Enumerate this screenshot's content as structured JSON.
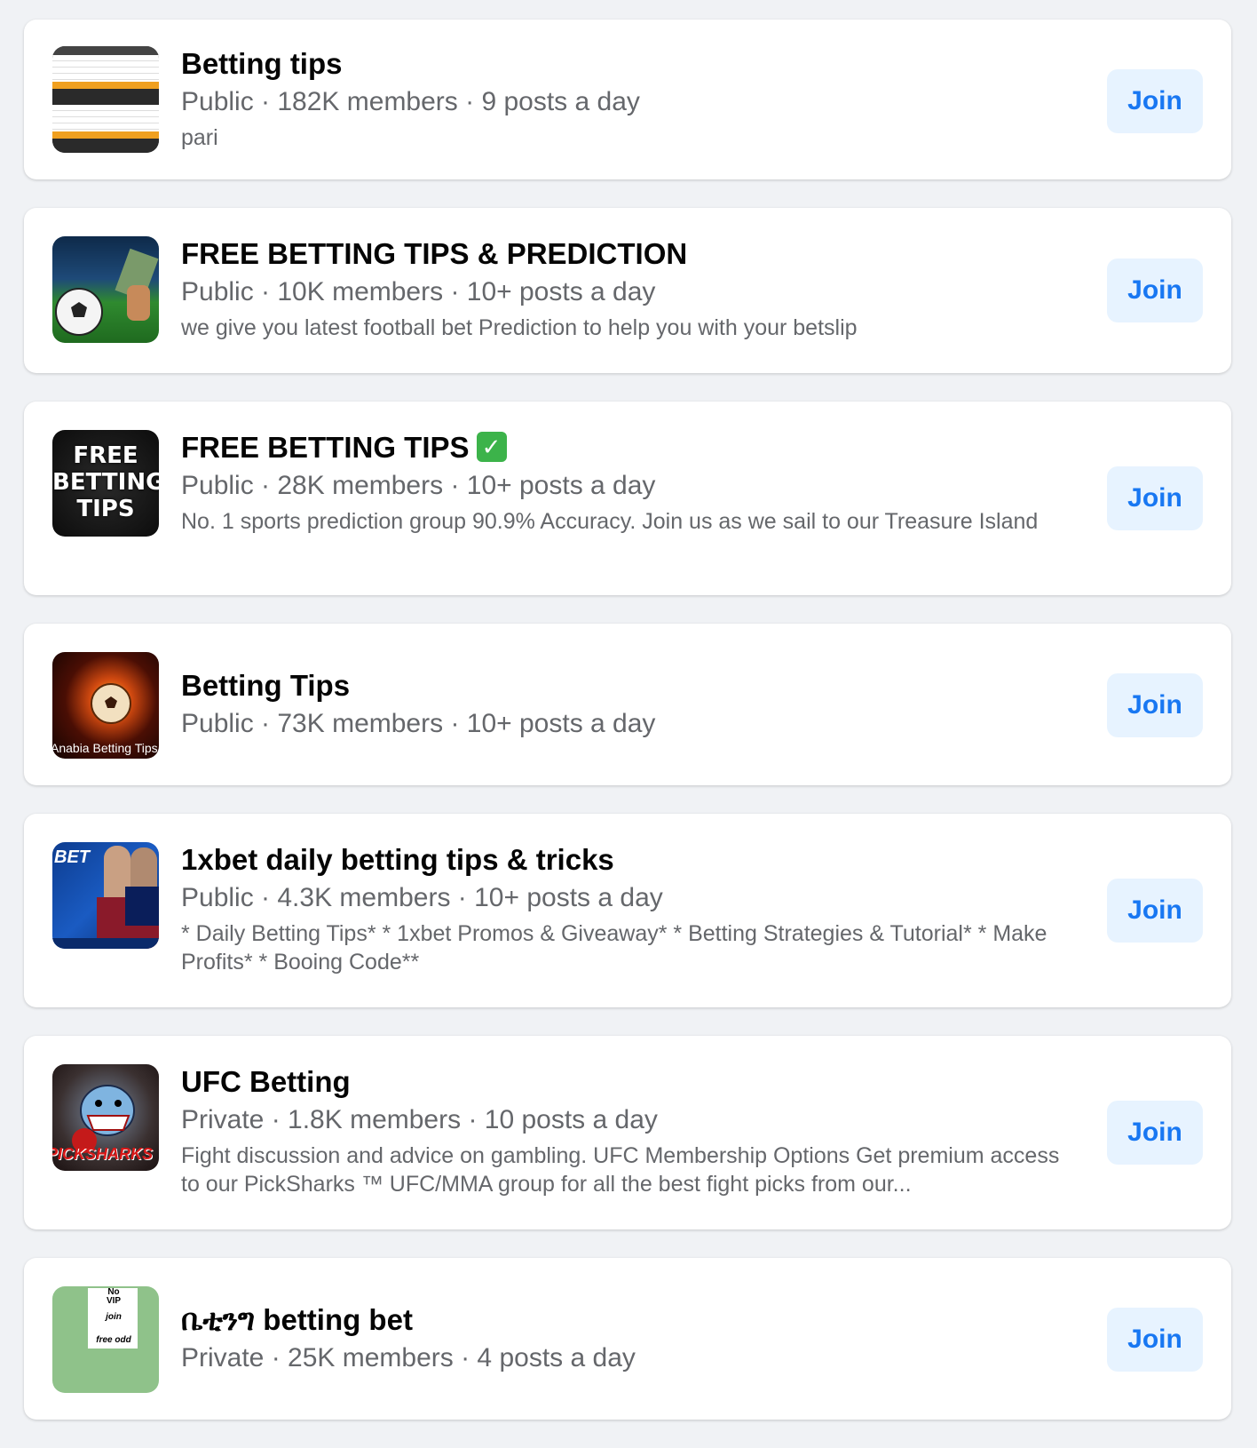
{
  "groups": [
    {
      "title": "Betting tips",
      "meta": "Public · 182K members · 9 posts a day",
      "description": "pari",
      "join_label": "Join"
    },
    {
      "title": "FREE BETTING TIPS & PREDICTION",
      "meta": "Public · 10K members · 10+ posts a day",
      "description": "we give you latest football bet Prediction to help you with your betslip",
      "join_label": "Join"
    },
    {
      "title": "FREE BETTING TIPS",
      "meta": "Public · 28K members · 10+ posts a day",
      "description": "No. 1 sports prediction group 90.9% Accuracy. Join us as we sail to our Treasure Island",
      "join_label": "Join",
      "thumb_text": [
        "FREE",
        "BETTING",
        "TIPS"
      ],
      "title_icon": "check-mark-icon"
    },
    {
      "title": "Betting Tips",
      "meta": "Public · 73K members · 10+ posts a day",
      "description": "",
      "join_label": "Join",
      "thumb_text": "Anabia Betting Tips"
    },
    {
      "title": "1xbet daily betting tips & tricks",
      "meta": "Public · 4.3K members · 10+ posts a day",
      "description": "* Daily Betting Tips* * 1xbet Promos & Giveaway* * Betting Strategies & Tutorial* * Make Profits* * Booing Code**",
      "join_label": "Join",
      "thumb_text": "BET"
    },
    {
      "title": "UFC Betting",
      "meta": "Private · 1.8K members · 10 posts a day",
      "description": "Fight discussion and advice on gambling. UFC Membership Options Get premium access to our PickSharks ™ UFC/MMA group for all the best fight picks from our...",
      "join_label": "Join",
      "thumb_text": "PICKSHARKS"
    },
    {
      "title": "ቤቲንግ betting bet",
      "meta": "Private · 25K members · 4 posts a day",
      "description": "",
      "join_label": "Join",
      "thumb_text": [
        "No",
        "VIP",
        "join",
        "free odd"
      ]
    }
  ],
  "colors": {
    "background": "#f0f2f5",
    "card": "#ffffff",
    "title": "#050505",
    "secondary_text": "#65676b",
    "join_bg": "#e7f3ff",
    "join_text": "#1877f2"
  }
}
